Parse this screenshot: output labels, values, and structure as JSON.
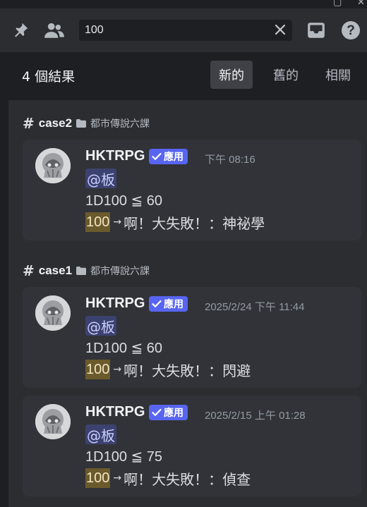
{
  "toolbar": {
    "pin_icon": "pin-icon",
    "members_icon": "members-icon",
    "inbox_icon": "inbox-icon",
    "help_icon": "help-icon"
  },
  "search": {
    "value": "100",
    "clear_icon": "close-icon"
  },
  "results": {
    "count_label": "4 個結果",
    "tabs": [
      {
        "label": "新的",
        "active": true
      },
      {
        "label": "舊的",
        "active": false
      },
      {
        "label": "相關",
        "active": false
      }
    ]
  },
  "groups": [
    {
      "channel": "case2",
      "category": "都市傳說六課",
      "messages": [
        {
          "username": "HKTRPG",
          "badge": "應用",
          "timestamp": "下午 08:16",
          "mention": "@板",
          "roll": "1D100 ≦ 60",
          "highlight": "100",
          "arrow": "→",
          "result": "啊！大失敗！：神祕學"
        }
      ]
    },
    {
      "channel": "case1",
      "category": "都市傳說六課",
      "messages": [
        {
          "username": "HKTRPG",
          "badge": "應用",
          "timestamp": "2025/2/24 下午 11:44",
          "mention": "@板",
          "roll": "1D100 ≦ 60",
          "highlight": "100",
          "arrow": "→",
          "result": "啊！大失敗！：閃避"
        },
        {
          "username": "HKTRPG",
          "badge": "應用",
          "timestamp": "2025/2/15 上午 01:28",
          "mention": "@板",
          "roll": "1D100 ≦ 75",
          "highlight": "100",
          "arrow": "→",
          "result": "啊！大失敗！：偵查"
        }
      ]
    }
  ],
  "colors": {
    "accent": "#5865f2",
    "highlight": "#6b5a2c",
    "card": "#313338",
    "panel": "#2b2d31"
  }
}
